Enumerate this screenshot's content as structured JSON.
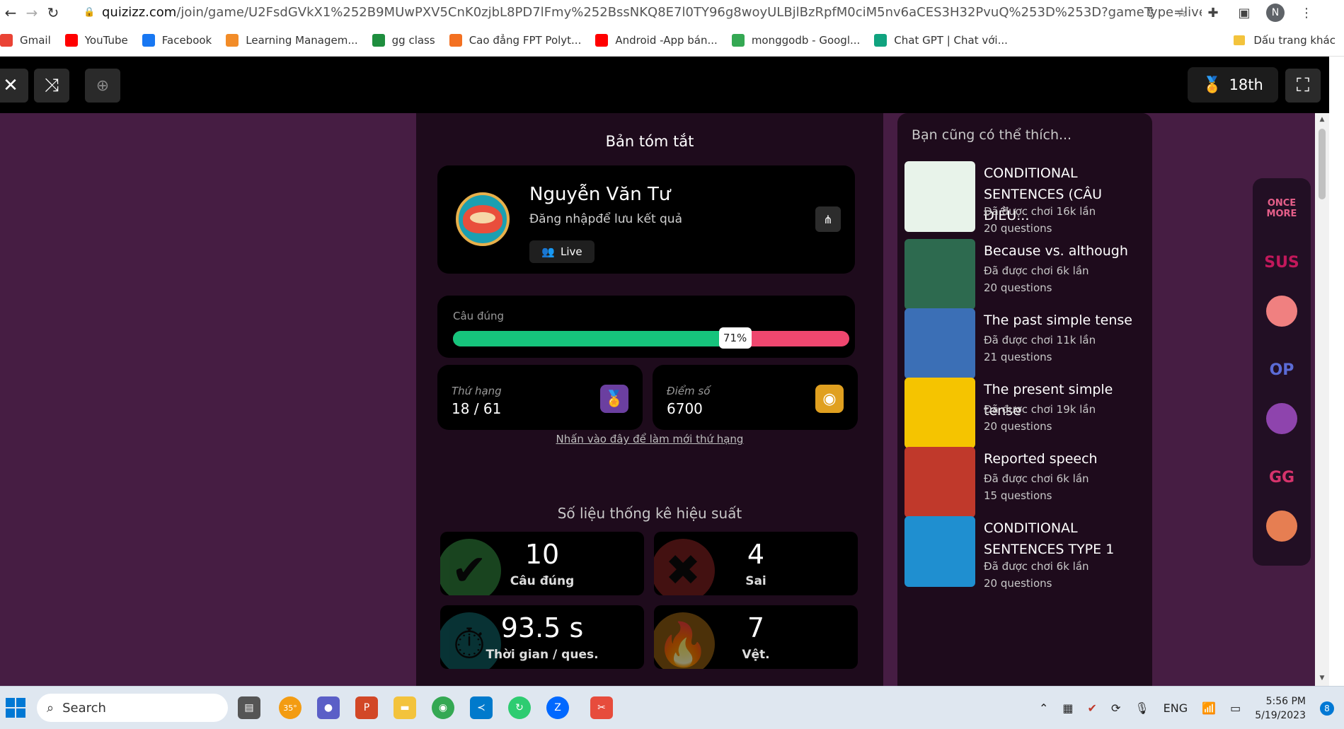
{
  "browser": {
    "url_host": "quizizz.com",
    "url_rest": "/join/game/U2FsdGVkX1%252B9MUwPXV5CnK0zjbL8PD7lFmy%252BssNKQ8E7l0TY96g8woyULBjlBzRpfM0ciM5nv6aCES3H32PvuQ%253D%253D?gameType=live&page=summary",
    "profile_initial": "N",
    "bookmarks": [
      {
        "label": "Gmail",
        "color": "#ea4335"
      },
      {
        "label": "YouTube",
        "color": "#ff0000"
      },
      {
        "label": "Facebook",
        "color": "#1877f2"
      },
      {
        "label": "Learning Managem...",
        "color": "#f28c28"
      },
      {
        "label": "gg class",
        "color": "#1e8e3e"
      },
      {
        "label": "Cao đẳng FPT Polyt...",
        "color": "#f37021"
      },
      {
        "label": "Android -App bán...",
        "color": "#ff0000"
      },
      {
        "label": "monggodb - Googl...",
        "color": "#34a853"
      },
      {
        "label": "Chat GPT | Chat với...",
        "color": "#10a37f"
      }
    ],
    "other_bookmarks": "Dấu trang khác"
  },
  "gamebar": {
    "rank_label": "18th"
  },
  "summary": {
    "title": "Bản tóm tắt",
    "player_name": "Nguyễn Văn Tư",
    "player_sub": "Đăng nhậpđể lưu kết quả",
    "live_label": "Live",
    "accuracy_label": "Câu đúng",
    "accuracy_percent": 71,
    "accuracy_text": "71%",
    "rank_label": "Thứ hạng",
    "rank_value": "18 / 61",
    "score_label": "Điểm số",
    "score_value": "6700",
    "refresh_link": "Nhấn vào đây để làm mới thứ hạng",
    "perf_title": "Số liệu thống kê hiệu suất",
    "stats": [
      {
        "num": "10",
        "label": "Câu đúng",
        "color": "#2f7d3a"
      },
      {
        "num": "4",
        "label": "Sai",
        "color": "#7a1f1f"
      },
      {
        "num": "93.5 s",
        "label": "Thời gian / ques.",
        "color": "#0f5c60"
      },
      {
        "num": "7",
        "label": "Vệt.",
        "color": "#8a5a12"
      }
    ]
  },
  "recommendations": {
    "title": "Bạn cũng có thể thích...",
    "items": [
      {
        "title": "CONDITIONAL SENTENCES (CÂU ĐIỀU...",
        "plays": "Đã được chơi 16k lần",
        "questions": "20 questions",
        "thumb_color": "#e8f3ea"
      },
      {
        "title": "Because vs. although",
        "plays": "Đã được chơi 6k lần",
        "questions": "20 questions",
        "thumb_color": "#2d6a4f"
      },
      {
        "title": "The past simple tense",
        "plays": "Đã được chơi 11k lần",
        "questions": "21 questions",
        "thumb_color": "#3b6fb6"
      },
      {
        "title": "The present simple tense",
        "plays": "Đã được chơi 19k lần",
        "questions": "20 questions",
        "thumb_color": "#f5c400"
      },
      {
        "title": "Reported speech",
        "plays": "Đã được chơi 6k lần",
        "questions": "15 questions",
        "thumb_color": "#c0392b"
      },
      {
        "title": "CONDITIONAL SENTENCES TYPE 1",
        "plays": "Đã được chơi 6k lần",
        "questions": "20 questions",
        "thumb_color": "#1f8fd0"
      }
    ]
  },
  "stickers": [
    "ONCE MORE",
    "SUS",
    "",
    "OP",
    "",
    "GG",
    ""
  ],
  "taskbar": {
    "search_label": "Search",
    "weather": "35°",
    "lang": "ENG",
    "time": "5:56 PM",
    "date": "5/19/2023",
    "notifications": "8"
  }
}
